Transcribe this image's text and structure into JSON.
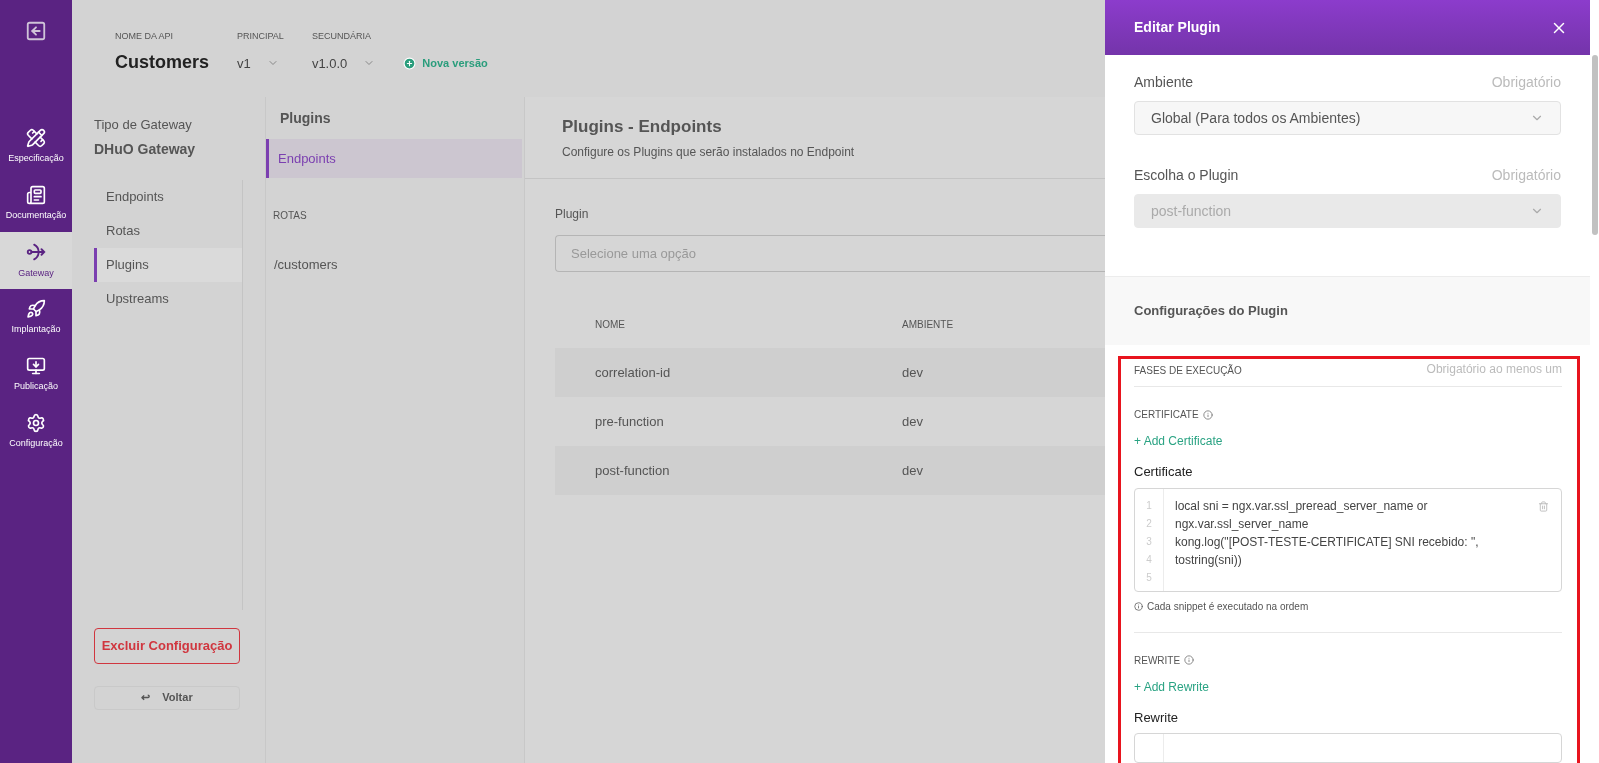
{
  "rail": {
    "items": [
      {
        "label": "Especificação",
        "selected": false
      },
      {
        "label": "Documentação",
        "selected": false
      },
      {
        "label": "Gateway",
        "selected": true
      },
      {
        "label": "Implantação",
        "selected": false
      },
      {
        "label": "Publicação",
        "selected": false
      },
      {
        "label": "Configuração",
        "selected": false
      }
    ]
  },
  "header": {
    "api_label": "NOME DA API",
    "api_name": "Customers",
    "principal": {
      "label": "PRINCIPAL",
      "value": "v1"
    },
    "secundaria": {
      "label": "SECUNDÁRIA",
      "value": "v1.0.0"
    },
    "new_version": "Nova versão"
  },
  "gateway_panel": {
    "type_label": "Tipo de Gateway",
    "type_value": "DHuO Gateway",
    "items": [
      {
        "label": "Endpoints",
        "selected": false
      },
      {
        "label": "Rotas",
        "selected": false
      },
      {
        "label": "Plugins",
        "selected": true
      },
      {
        "label": "Upstreams",
        "selected": false
      }
    ],
    "delete_button": "Excluir Configuração",
    "back_icon": "↩",
    "back_button": "Voltar"
  },
  "plugins_panel": {
    "title": "Plugins",
    "items": [
      {
        "label": "Endpoints",
        "selected": true
      }
    ],
    "routes_label": "ROTAS",
    "routes": [
      {
        "label": "/customers",
        "selected": false
      }
    ]
  },
  "main": {
    "title": "Plugins - Endpoints",
    "subtitle": "Configure os Plugins que serão instalados no Endpoint",
    "plugin_label": "Plugin",
    "plugin_placeholder": "Selecione uma opção",
    "table": {
      "columns": [
        "NOME",
        "AMBIENTE"
      ],
      "rows": [
        [
          "correlation-id",
          "dev"
        ],
        [
          "pre-function",
          "dev"
        ],
        [
          "post-function",
          "dev"
        ]
      ]
    }
  },
  "drawer": {
    "title": "Editar Plugin",
    "ambiente": {
      "label": "Ambiente",
      "required": "Obrigatório",
      "value": "Global (Para todos os Ambientes)",
      "disabled": false
    },
    "plugin": {
      "label": "Escolha o Plugin",
      "required": "Obrigatório",
      "value": "post-function",
      "disabled": true
    },
    "config_title": "Configurações do Plugin",
    "phases": {
      "title": "FASES DE EXECUÇÃO",
      "required": "Obrigatório ao menos um",
      "sections": [
        {
          "title": "CERTIFICATE",
          "add": "+ Add Certificate",
          "field_label": "Certificate",
          "line_numbers": [
            "1",
            "2",
            "3",
            "4",
            "5"
          ],
          "code": "local sni = ngx.var.ssl_preread_server_name or ngx.var.ssl_server_name\nkong.log(\"[POST-TESTE-CERTIFICATE] SNI recebido: \", tostring(sni))",
          "hint": "Cada snippet é executado na ordem"
        },
        {
          "title": "REWRITE",
          "add": "+ Add Rewrite",
          "field_label": "Rewrite"
        }
      ]
    }
  }
}
